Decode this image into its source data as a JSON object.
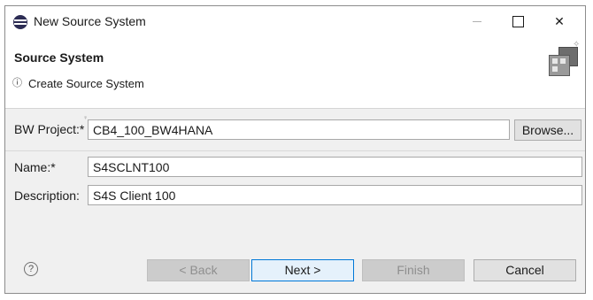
{
  "window": {
    "title": "New Source System",
    "icon": "eclipse-app-icon",
    "controls": {
      "minimize": "minimize-icon",
      "maximize": "maximize-icon",
      "close": "close-icon",
      "close_glyph": "✕"
    }
  },
  "header": {
    "title": "Source System",
    "message_icon": "ⓘ",
    "message": "Create Source System",
    "graphic": "wizard-banner-icon"
  },
  "form": {
    "project": {
      "label": "BW Project:*",
      "value": "CB4_100_BW4HANA"
    },
    "name": {
      "label": "Name:*",
      "value": "S4SCLNT100"
    },
    "description": {
      "label": "Description:",
      "value": "S4S Client 100"
    },
    "browse_label": "Browse..."
  },
  "buttons": {
    "help_glyph": "?",
    "back": "< Back",
    "next": "Next >",
    "finish": "Finish",
    "cancel": "Cancel"
  },
  "colors": {
    "default_button_border": "#0078d7",
    "default_button_bg": "#e5f1fb",
    "dialog_bg": "#f0f0f0"
  }
}
